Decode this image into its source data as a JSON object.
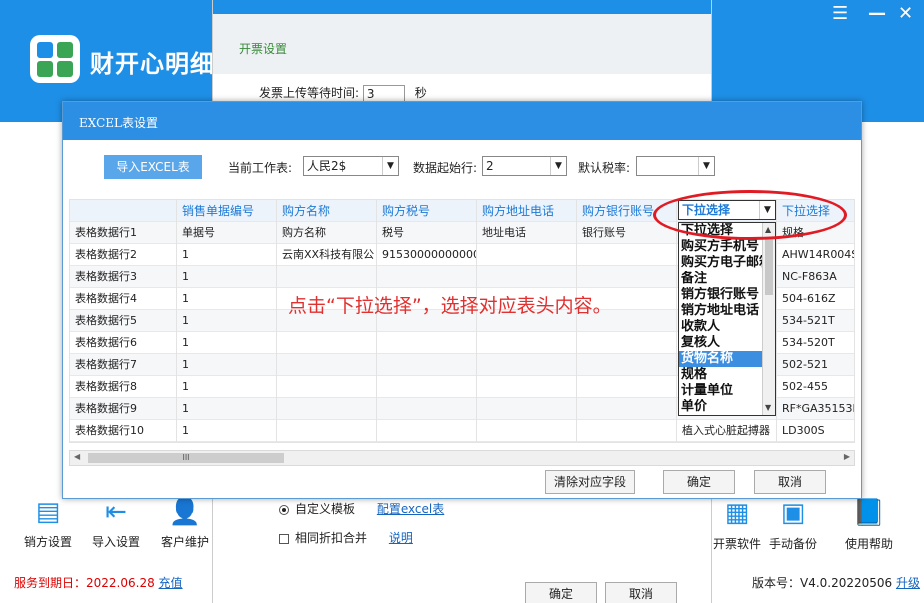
{
  "app": {
    "title": "财开心明细",
    "expire_label": "服务到期日：2022.06.28",
    "recharge": "充值",
    "version_label": "版本号：V4.0.20220506",
    "upgrade": "升级",
    "left_tools": [
      "销方设置",
      "导入设置",
      "客户维护"
    ],
    "right_tools": [
      "开票软件",
      "手动备份",
      "使用帮助"
    ]
  },
  "settings": {
    "section": "开票设置",
    "upload_wait_label": "发票上传等待时间:",
    "upload_wait_value": "3",
    "upload_wait_unit": "秒",
    "custom_template": "自定义模板",
    "config_excel": "配置excel表",
    "merge_discount": "相同折扣合并",
    "explain": "说明",
    "ok": "确定",
    "cancel": "取消"
  },
  "dialog": {
    "title": "EXCEL表设置",
    "import_btn": "导入EXCEL表",
    "sheet_label": "当前工作表:",
    "sheet_value": "人民2$",
    "start_row_label": "数据起始行:",
    "start_row_value": "2",
    "tax_rate_label": "默认税率:",
    "tax_rate_value": "",
    "clear_btn": "清除对应字段",
    "ok": "确定",
    "cancel": "取消",
    "hint": "点击“下拉选择”，选择对应表头内容。",
    "scroll_glyph": "III",
    "scroll_left": "◀",
    "scroll_right": "▶",
    "arrow": "▼"
  },
  "grid": {
    "headers": [
      "",
      "销售单据编号",
      "购方名称",
      "购方税号",
      "购方地址电话",
      "购方银行账号",
      "下拉选择",
      "下拉选择"
    ],
    "rows": [
      [
        "表格数据行1",
        "单据号",
        "购方名称",
        "税号",
        "地址电话",
        "银行账号",
        "",
        "规格"
      ],
      [
        "表格数据行2",
        "1",
        "云南XX科技有限公",
        "91530000000000000",
        "",
        "",
        "",
        "AHW14R004S"
      ],
      [
        "表格数据行3",
        "1",
        "",
        "",
        "",
        "",
        "",
        "NC-F863A"
      ],
      [
        "表格数据行4",
        "1",
        "",
        "",
        "",
        "",
        "",
        "504-616Z"
      ],
      [
        "表格数据行5",
        "1",
        "",
        "",
        "",
        "",
        "",
        "534-521T"
      ],
      [
        "表格数据行6",
        "1",
        "",
        "",
        "",
        "",
        "",
        "534-520T"
      ],
      [
        "表格数据行7",
        "1",
        "",
        "",
        "",
        "",
        "",
        "502-521"
      ],
      [
        "表格数据行8",
        "1",
        "",
        "",
        "",
        "",
        "",
        "502-455"
      ],
      [
        "表格数据行9",
        "1",
        "",
        "",
        "",
        "",
        "",
        "RF*GA35153M"
      ],
      [
        "表格数据行10",
        "1",
        "",
        "",
        "",
        "",
        "植入式心脏起搏器",
        "LD300S"
      ]
    ]
  },
  "dropdown": {
    "current": "下拉选择",
    "options": [
      "下拉选择",
      "购买方手机号",
      "购买方电子邮箱",
      "备注",
      "销方银行账号",
      "销方地址电话",
      "收款人",
      "复核人",
      "货物名称",
      "规格",
      "计量单位",
      "单价"
    ],
    "selected_index": 8
  },
  "colors": {
    "brand_blue": "#1e8fe6",
    "hint_red": "#e0302f",
    "header_text": "#1e7ad6"
  }
}
